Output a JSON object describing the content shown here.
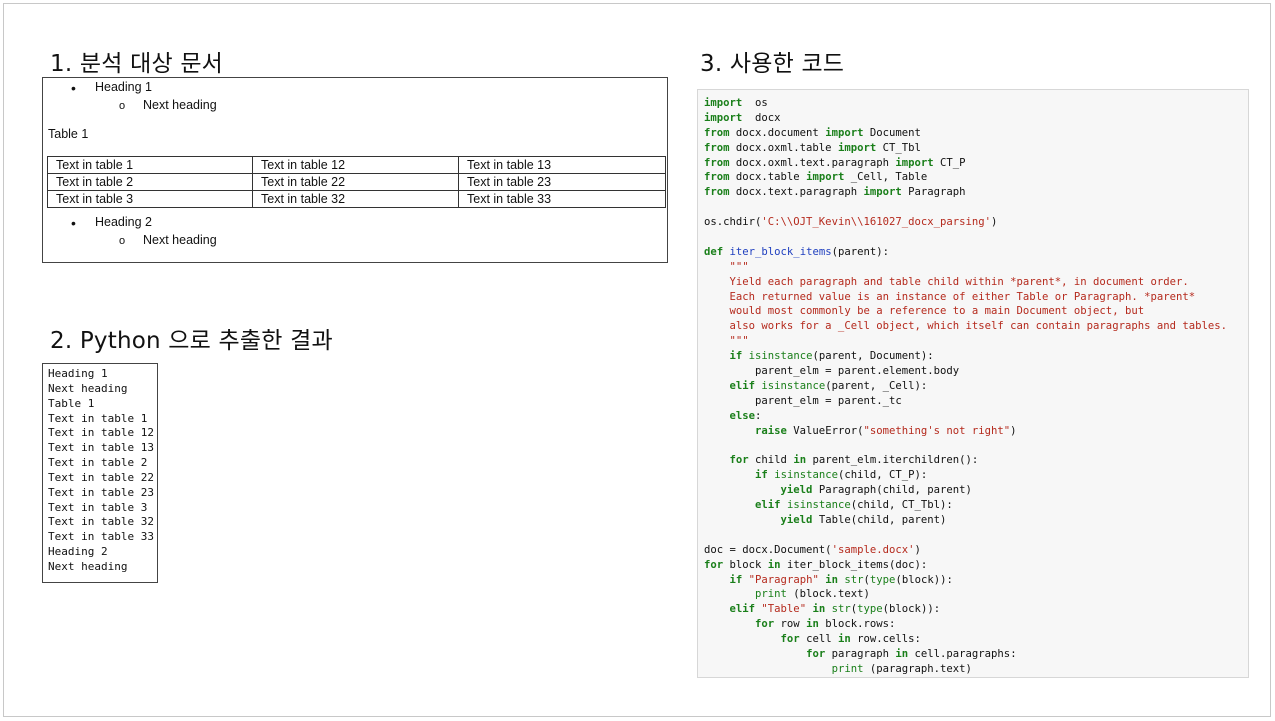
{
  "headings": {
    "doc": "1. 분석 대상 문서",
    "result": "2. Python 으로 추출한 결과",
    "code": "3. 사용한 코드"
  },
  "document": {
    "bullets_top": [
      {
        "level": 1,
        "text": "Heading 1"
      },
      {
        "level": 2,
        "text": "Next heading"
      }
    ],
    "table_caption": "Table 1",
    "table_rows": [
      [
        "Text in table 1",
        "Text in table 12",
        "Text in table 13"
      ],
      [
        "Text in table 2",
        "Text in table 22",
        "Text in table 23"
      ],
      [
        "Text in table 3",
        "Text in table 32",
        "Text in table 33"
      ]
    ],
    "bullets_bottom": [
      {
        "level": 1,
        "text": "Heading 2"
      },
      {
        "level": 2,
        "text": "Next heading"
      }
    ]
  },
  "result_lines": [
    "Heading 1",
    "Next heading",
    "Table 1",
    "Text in table 1",
    "Text in table 12",
    "Text in table 13",
    "Text in table 2",
    "Text in table 22",
    "Text in table 23",
    "Text in table 3",
    "Text in table 32",
    "Text in table 33",
    "Heading 2",
    "Next heading"
  ],
  "code_lines": [
    [
      [
        "kw",
        "import"
      ],
      [
        "",
        "  os"
      ]
    ],
    [
      [
        "kw",
        "import"
      ],
      [
        "",
        "  docx"
      ]
    ],
    [
      [
        "kw",
        "from"
      ],
      [
        "",
        " docx.document "
      ],
      [
        "kw",
        "import"
      ],
      [
        "",
        " Document"
      ]
    ],
    [
      [
        "kw",
        "from"
      ],
      [
        "",
        " docx.oxml.table "
      ],
      [
        "kw",
        "import"
      ],
      [
        "",
        " CT_Tbl"
      ]
    ],
    [
      [
        "kw",
        "from"
      ],
      [
        "",
        " docx.oxml.text.paragraph "
      ],
      [
        "kw",
        "import"
      ],
      [
        "",
        " CT_P"
      ]
    ],
    [
      [
        "kw",
        "from"
      ],
      [
        "",
        " docx.table "
      ],
      [
        "kw",
        "import"
      ],
      [
        "",
        " _Cell, Table"
      ]
    ],
    [
      [
        "kw",
        "from"
      ],
      [
        "",
        " docx.text.paragraph "
      ],
      [
        "kw",
        "import"
      ],
      [
        "",
        " Paragraph"
      ]
    ],
    [],
    [
      [
        "",
        "os.chdir("
      ],
      [
        "st",
        "'C:\\\\OJT_Kevin\\\\161027_docx_parsing'"
      ],
      [
        "",
        ")"
      ]
    ],
    [],
    [
      [
        "kw",
        "def"
      ],
      [
        "",
        " "
      ],
      [
        "fn",
        "iter_block_items"
      ],
      [
        "",
        "(parent):"
      ]
    ],
    [
      [
        "st",
        "    \"\"\""
      ]
    ],
    [
      [
        "st",
        "    Yield each paragraph and table child within *parent*, in document order."
      ]
    ],
    [
      [
        "st",
        "    Each returned value is an instance of either Table or Paragraph. *parent*"
      ]
    ],
    [
      [
        "st",
        "    would most commonly be a reference to a main Document object, but"
      ]
    ],
    [
      [
        "st",
        "    also works for a _Cell object, which itself can contain paragraphs and tables."
      ]
    ],
    [
      [
        "st",
        "    \"\"\""
      ]
    ],
    [
      [
        "",
        "    "
      ],
      [
        "kw",
        "if"
      ],
      [
        "",
        " "
      ],
      [
        "bi",
        "isinstance"
      ],
      [
        "",
        "(parent, Document):"
      ]
    ],
    [
      [
        "",
        "        parent_elm = parent.element.body"
      ]
    ],
    [
      [
        "",
        "    "
      ],
      [
        "kw",
        "elif"
      ],
      [
        "",
        " "
      ],
      [
        "bi",
        "isinstance"
      ],
      [
        "",
        "(parent, _Cell):"
      ]
    ],
    [
      [
        "",
        "        parent_elm = parent._tc"
      ]
    ],
    [
      [
        "",
        "    "
      ],
      [
        "kw",
        "else"
      ],
      [
        "",
        ":"
      ]
    ],
    [
      [
        "",
        "        "
      ],
      [
        "kw",
        "raise"
      ],
      [
        "",
        " ValueError("
      ],
      [
        "st",
        "\"something's not right\""
      ],
      [
        "",
        ")"
      ]
    ],
    [],
    [
      [
        "",
        "    "
      ],
      [
        "kw",
        "for"
      ],
      [
        "",
        " child "
      ],
      [
        "kw",
        "in"
      ],
      [
        "",
        " parent_elm.iterchildren():"
      ]
    ],
    [
      [
        "",
        "        "
      ],
      [
        "kw",
        "if"
      ],
      [
        "",
        " "
      ],
      [
        "bi",
        "isinstance"
      ],
      [
        "",
        "(child, CT_P):"
      ]
    ],
    [
      [
        "",
        "            "
      ],
      [
        "kw",
        "yield"
      ],
      [
        "",
        " Paragraph(child, parent)"
      ]
    ],
    [
      [
        "",
        "        "
      ],
      [
        "kw",
        "elif"
      ],
      [
        "",
        " "
      ],
      [
        "bi",
        "isinstance"
      ],
      [
        "",
        "(child, CT_Tbl):"
      ]
    ],
    [
      [
        "",
        "            "
      ],
      [
        "kw",
        "yield"
      ],
      [
        "",
        " Table(child, parent)"
      ]
    ],
    [],
    [
      [
        "",
        "doc = docx.Document("
      ],
      [
        "st",
        "'sample.docx'"
      ],
      [
        "",
        ")"
      ]
    ],
    [
      [
        "kw",
        "for"
      ],
      [
        "",
        " block "
      ],
      [
        "kw",
        "in"
      ],
      [
        "",
        " iter_block_items(doc):"
      ]
    ],
    [
      [
        "",
        "    "
      ],
      [
        "kw",
        "if"
      ],
      [
        "",
        " "
      ],
      [
        "st",
        "\"Paragraph\""
      ],
      [
        "",
        " "
      ],
      [
        "kw",
        "in"
      ],
      [
        "",
        " "
      ],
      [
        "bi",
        "str"
      ],
      [
        "",
        "("
      ],
      [
        "bi",
        "type"
      ],
      [
        "",
        "(block)):"
      ]
    ],
    [
      [
        "",
        "        "
      ],
      [
        "bi",
        "print"
      ],
      [
        "",
        " (block.text)"
      ]
    ],
    [
      [
        "",
        "    "
      ],
      [
        "kw",
        "elif"
      ],
      [
        "",
        " "
      ],
      [
        "st",
        "\"Table\""
      ],
      [
        "",
        " "
      ],
      [
        "kw",
        "in"
      ],
      [
        "",
        " "
      ],
      [
        "bi",
        "str"
      ],
      [
        "",
        "("
      ],
      [
        "bi",
        "type"
      ],
      [
        "",
        "(block)):"
      ]
    ],
    [
      [
        "",
        "        "
      ],
      [
        "kw",
        "for"
      ],
      [
        "",
        " row "
      ],
      [
        "kw",
        "in"
      ],
      [
        "",
        " block.rows:"
      ]
    ],
    [
      [
        "",
        "            "
      ],
      [
        "kw",
        "for"
      ],
      [
        "",
        " cell "
      ],
      [
        "kw",
        "in"
      ],
      [
        "",
        " row.cells:"
      ]
    ],
    [
      [
        "",
        "                "
      ],
      [
        "kw",
        "for"
      ],
      [
        "",
        " paragraph "
      ],
      [
        "kw",
        "in"
      ],
      [
        "",
        " cell.paragraphs:"
      ]
    ],
    [
      [
        "",
        "                    "
      ],
      [
        "bi",
        "print"
      ],
      [
        "",
        " (paragraph.text)"
      ]
    ]
  ],
  "colors": {
    "keyword": "#1a7f1a",
    "string": "#b52a1d",
    "function_name": "#1f3fbf",
    "code_background": "#f7f7f7"
  }
}
